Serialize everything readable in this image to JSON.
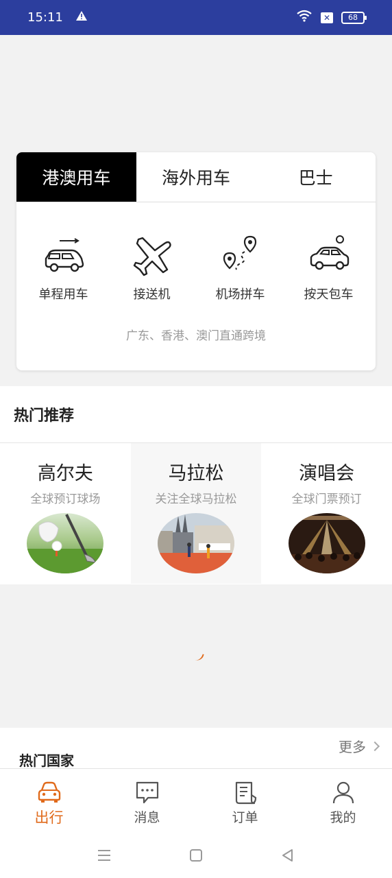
{
  "status_bar": {
    "time": "15:11",
    "battery": "68",
    "icons": [
      "alert-icon",
      "wifi-icon",
      "sim-off-icon",
      "battery-icon"
    ]
  },
  "tabs": [
    {
      "label": "港澳用车",
      "active": true
    },
    {
      "label": "海外用车",
      "active": false
    },
    {
      "label": "巴士",
      "active": false
    }
  ],
  "services": [
    {
      "label": "单程用车",
      "icon": "van-icon"
    },
    {
      "label": "接送机",
      "icon": "airplane-icon"
    },
    {
      "label": "机场拼车",
      "icon": "route-pin-icon"
    },
    {
      "label": "按天包车",
      "icon": "car-icon"
    }
  ],
  "service_note": "广东、香港、澳门直通跨境",
  "recommend": {
    "title": "热门推荐",
    "items": [
      {
        "title": "高尔夫",
        "subtitle": "全球预订球场",
        "image": "golf-image"
      },
      {
        "title": "马拉松",
        "subtitle": "关注全球马拉松",
        "image": "marathon-image"
      },
      {
        "title": "演唱会",
        "subtitle": "全球门票预订",
        "image": "concert-image"
      }
    ]
  },
  "countries": {
    "title": "热门国家",
    "more": "更多"
  },
  "bottom_nav": [
    {
      "label": "出行",
      "icon": "car-front-icon",
      "active": true
    },
    {
      "label": "消息",
      "icon": "message-icon",
      "active": false
    },
    {
      "label": "订单",
      "icon": "order-icon",
      "active": false
    },
    {
      "label": "我的",
      "icon": "user-icon",
      "active": false
    }
  ],
  "colors": {
    "status_bar": "#2c3e9e",
    "accent": "#e06a1b",
    "active_tab": "#000000"
  }
}
